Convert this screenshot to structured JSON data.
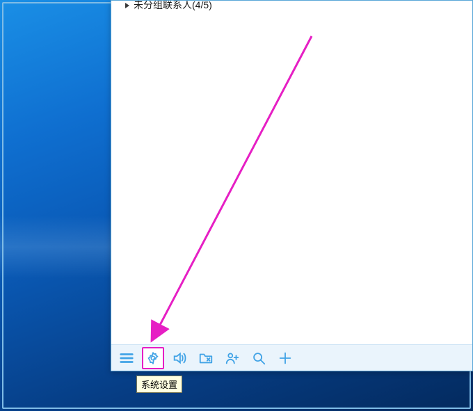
{
  "panel": {
    "contact_group_label": "未分组联系人(4/5)"
  },
  "toolbar": {
    "menu_name": "menu-icon",
    "settings_name": "gear-icon",
    "sound_name": "sound-icon",
    "folder_name": "folder-icon",
    "adduser_name": "add-user-icon",
    "search_name": "search-icon",
    "plus_name": "plus-icon"
  },
  "tooltip": {
    "settings": "系统设置"
  },
  "annotation": {
    "color": "#e61fc4"
  }
}
